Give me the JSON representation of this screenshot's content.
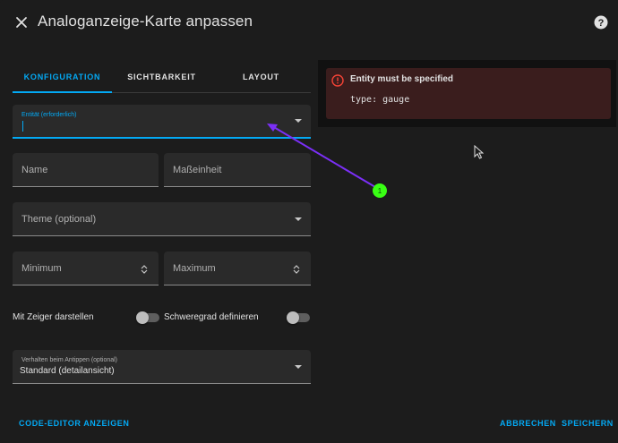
{
  "header": {
    "title": "Analoganzeige-Karte anpassen"
  },
  "tabs": [
    {
      "label": "KONFIGURATION",
      "active": true
    },
    {
      "label": "SICHTBARKEIT",
      "active": false
    },
    {
      "label": "LAYOUT",
      "active": false
    }
  ],
  "form": {
    "entity": {
      "label": "Entität (erforderlich)",
      "value": ""
    },
    "name": {
      "label": "Name",
      "value": ""
    },
    "unit": {
      "label": "Maßeinheit",
      "value": ""
    },
    "theme": {
      "label": "Theme (optional)",
      "value": ""
    },
    "minimum": {
      "label": "Minimum",
      "value": ""
    },
    "maximum": {
      "label": "Maximum",
      "value": ""
    },
    "needle": {
      "label": "Mit Zeiger darstellen",
      "checked": false
    },
    "severity": {
      "label": "Schweregrad definieren",
      "checked": false
    },
    "tap_action": {
      "label": "Verhalten beim Antippen (optional)",
      "value": "Standard (detailansicht)"
    }
  },
  "footer": {
    "code_editor": "CODE-EDITOR ANZEIGEN",
    "cancel": "ABBRECHEN",
    "save": "SPEICHERN"
  },
  "preview": {
    "error_title": "Entity must be specified",
    "error_code": "type: gauge"
  },
  "annotation": {
    "marker_label": "1"
  },
  "colors": {
    "accent": "#03a9f4",
    "error": "#f44336",
    "annotation_arrow": "#7b2ff7",
    "annotation_marker": "#39ff14"
  },
  "icons": {
    "close": "close-icon",
    "help": "help-circle-icon",
    "error": "alert-circle-icon",
    "dropdown": "menu-down-icon",
    "spinner": "unfold-icon"
  }
}
